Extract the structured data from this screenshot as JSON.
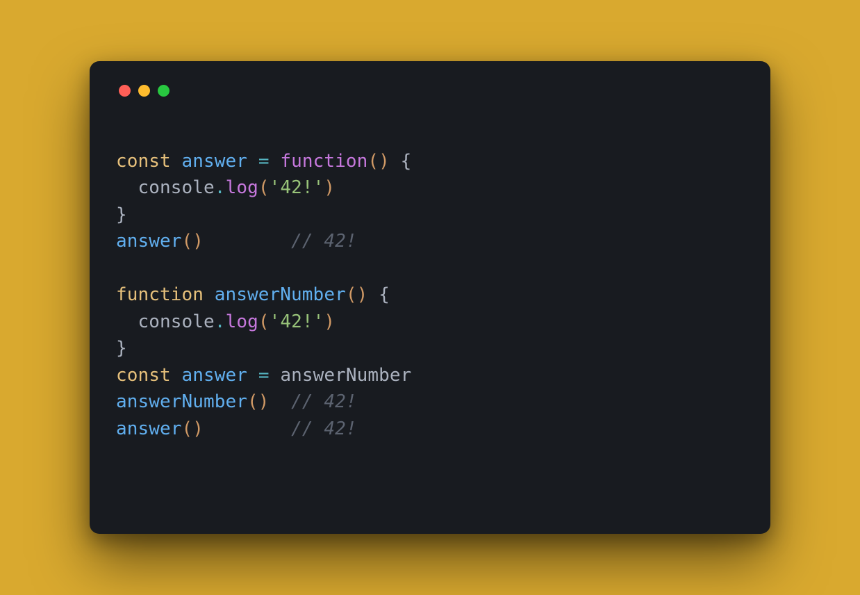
{
  "window": {
    "buttons": [
      "close",
      "minimize",
      "zoom"
    ]
  },
  "code": {
    "lines": [
      [
        {
          "t": "const ",
          "c": "tok-kw"
        },
        {
          "t": "answer",
          "c": "tok-name"
        },
        {
          "t": " ",
          "c": ""
        },
        {
          "t": "=",
          "c": "tok-op"
        },
        {
          "t": " ",
          "c": ""
        },
        {
          "t": "function",
          "c": "tok-kw2"
        },
        {
          "t": "()",
          "c": "tok-paren"
        },
        {
          "t": " ",
          "c": ""
        },
        {
          "t": "{",
          "c": "tok-brace"
        }
      ],
      [
        {
          "t": "  ",
          "c": ""
        },
        {
          "t": "console",
          "c": "tok-ident"
        },
        {
          "t": ".",
          "c": "tok-op"
        },
        {
          "t": "log",
          "c": "tok-prop"
        },
        {
          "t": "(",
          "c": "tok-paren"
        },
        {
          "t": "'42!'",
          "c": "tok-str"
        },
        {
          "t": ")",
          "c": "tok-paren"
        }
      ],
      [
        {
          "t": "}",
          "c": "tok-brace"
        }
      ],
      [
        {
          "t": "answer",
          "c": "tok-name"
        },
        {
          "t": "()",
          "c": "tok-paren"
        },
        {
          "t": "        ",
          "c": ""
        },
        {
          "t": "// 42!",
          "c": "tok-comment"
        }
      ],
      [
        {
          "t": " ",
          "c": ""
        }
      ],
      [
        {
          "t": "function ",
          "c": "tok-kw"
        },
        {
          "t": "answerNumber",
          "c": "tok-name"
        },
        {
          "t": "()",
          "c": "tok-paren"
        },
        {
          "t": " ",
          "c": ""
        },
        {
          "t": "{",
          "c": "tok-brace"
        }
      ],
      [
        {
          "t": "  ",
          "c": ""
        },
        {
          "t": "console",
          "c": "tok-ident"
        },
        {
          "t": ".",
          "c": "tok-op"
        },
        {
          "t": "log",
          "c": "tok-prop"
        },
        {
          "t": "(",
          "c": "tok-paren"
        },
        {
          "t": "'42!'",
          "c": "tok-str"
        },
        {
          "t": ")",
          "c": "tok-paren"
        }
      ],
      [
        {
          "t": "}",
          "c": "tok-brace"
        }
      ],
      [
        {
          "t": "const ",
          "c": "tok-kw"
        },
        {
          "t": "answer",
          "c": "tok-name"
        },
        {
          "t": " ",
          "c": ""
        },
        {
          "t": "=",
          "c": "tok-op"
        },
        {
          "t": " ",
          "c": ""
        },
        {
          "t": "answerNumber",
          "c": "tok-ident"
        }
      ],
      [
        {
          "t": "answerNumber",
          "c": "tok-name"
        },
        {
          "t": "()",
          "c": "tok-paren"
        },
        {
          "t": "  ",
          "c": ""
        },
        {
          "t": "// 42!",
          "c": "tok-comment"
        }
      ],
      [
        {
          "t": "answer",
          "c": "tok-name"
        },
        {
          "t": "()",
          "c": "tok-paren"
        },
        {
          "t": "        ",
          "c": ""
        },
        {
          "t": "// 42!",
          "c": "tok-comment"
        }
      ]
    ]
  }
}
